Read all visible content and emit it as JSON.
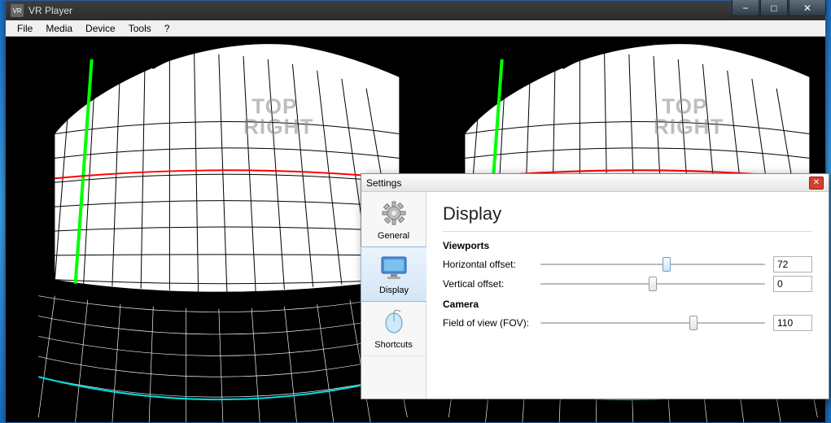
{
  "window": {
    "title": "VR Player",
    "controls": {
      "min_label": "−",
      "max_label": "□",
      "close_label": "✕"
    }
  },
  "menu": {
    "items": [
      "File",
      "Media",
      "Device",
      "Tools",
      "?"
    ]
  },
  "viewport": {
    "overlay_line1": "TOP",
    "overlay_line2": "RIGHT"
  },
  "settings": {
    "title": "Settings",
    "close_label": "✕",
    "sidebar": {
      "items": [
        {
          "label": "General",
          "icon": "gear-icon",
          "selected": false
        },
        {
          "label": "Display",
          "icon": "monitor-icon",
          "selected": true
        },
        {
          "label": "Shortcuts",
          "icon": "mouse-icon",
          "selected": false
        }
      ]
    },
    "heading": "Display",
    "sections": {
      "viewports": {
        "label": "Viewports",
        "horizontal_offset": {
          "label": "Horizontal offset:",
          "value": "72",
          "thumb_pct": 56,
          "thumb_variant": "blue"
        },
        "vertical_offset": {
          "label": "Vertical offset:",
          "value": "0",
          "thumb_pct": 50,
          "thumb_variant": "gray"
        }
      },
      "camera": {
        "label": "Camera",
        "fov": {
          "label": "Field of view (FOV):",
          "value": "110",
          "thumb_pct": 68,
          "thumb_variant": "gray"
        }
      }
    }
  }
}
